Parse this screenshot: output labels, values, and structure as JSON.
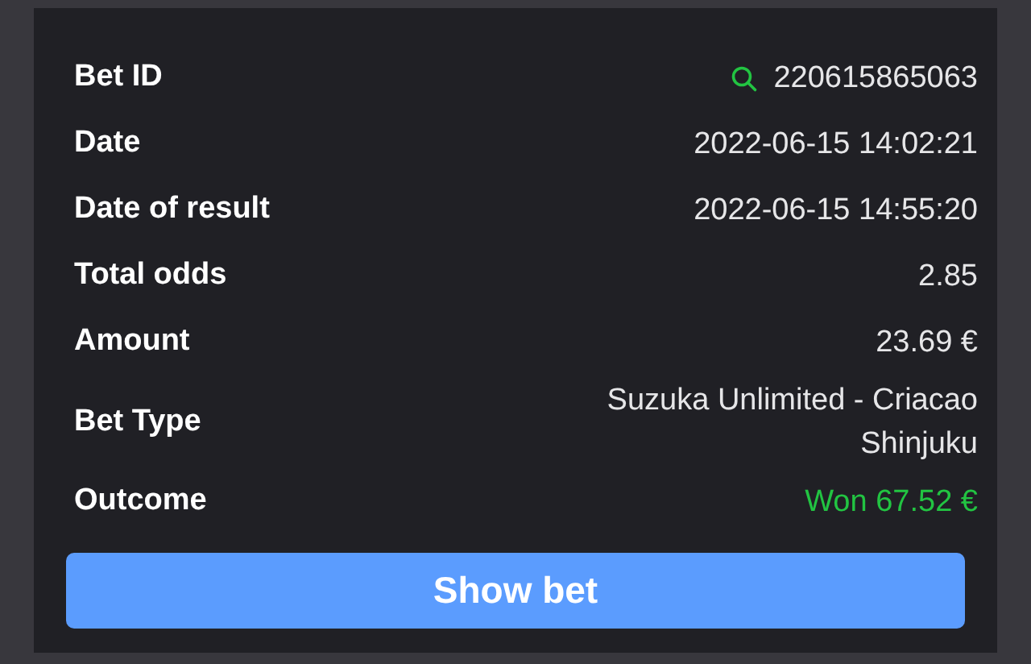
{
  "details": [
    {
      "kind": "id",
      "label": "Bet ID",
      "value": "220615865063"
    },
    {
      "kind": "plain",
      "label": "Date",
      "value": "2022-06-15 14:02:21"
    },
    {
      "kind": "plain",
      "label": "Date of result",
      "value": "2022-06-15 14:55:20"
    },
    {
      "kind": "plain",
      "label": "Total odds",
      "value": "2.85"
    },
    {
      "kind": "plain",
      "label": "Amount",
      "value": "23.69 €"
    },
    {
      "kind": "plain",
      "label": "Bet Type",
      "value": "Suzuka Unlimited - Criacao Shinjuku"
    },
    {
      "kind": "won",
      "label": "Outcome",
      "value": "Won 67.52 €"
    }
  ],
  "button": "Show bet"
}
